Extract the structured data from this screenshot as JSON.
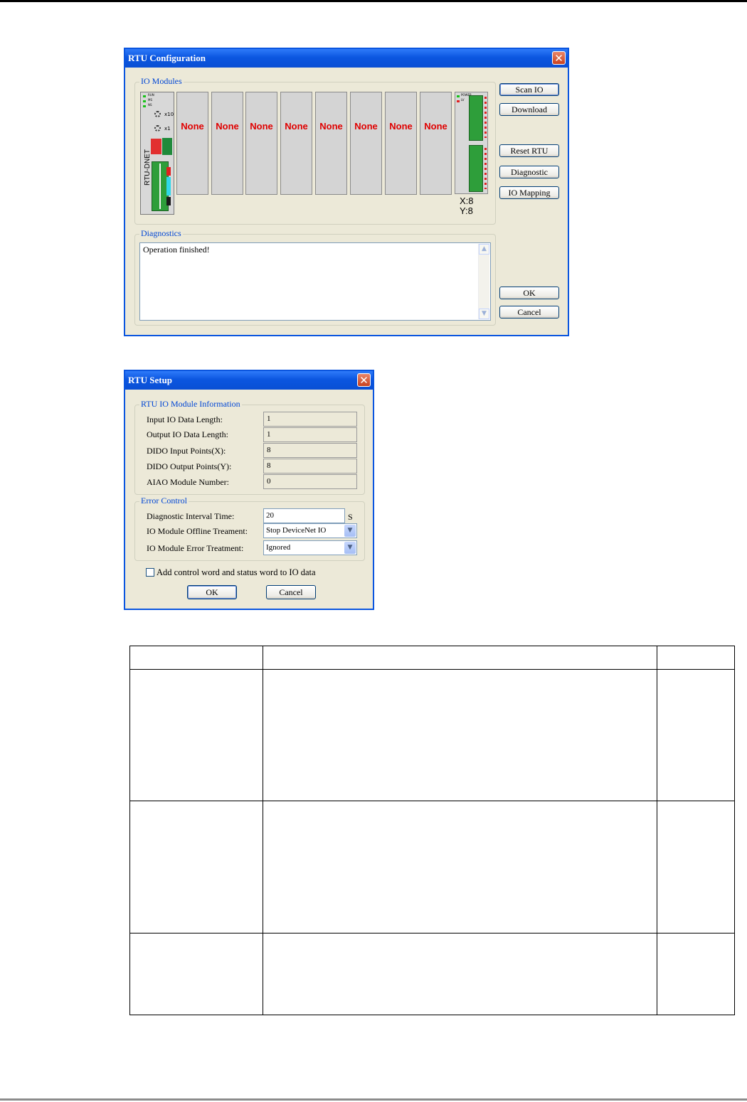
{
  "rtu_configuration": {
    "title": "RTU Configuration",
    "close_glyph": "✕",
    "io_modules_label": "IO Modules",
    "rtu_module": {
      "name": "RTU-DNET",
      "led_labels": [
        "RUN",
        "MS",
        "NS"
      ],
      "switch_labels": [
        "x10",
        "x1"
      ]
    },
    "slots": [
      "None",
      "None",
      "None",
      "None",
      "None",
      "None",
      "None",
      "None"
    ],
    "io_summary": {
      "led_labels": [
        "POWER",
        "LV"
      ],
      "x": "X:8",
      "y": "Y:8"
    },
    "buttons": {
      "scan_io": "Scan IO",
      "download": "Download",
      "reset_rtu": "Reset RTU",
      "diagnostic": "Diagnostic",
      "io_mapping": "IO Mapping",
      "ok": "OK",
      "cancel": "Cancel"
    },
    "diagnostics_label": "Diagnostics",
    "diagnostics_text": "Operation finished!"
  },
  "rtu_setup": {
    "title": "RTU Setup",
    "close_glyph": "✕",
    "info_group_label": "RTU IO Module Information",
    "info_rows": [
      {
        "label": "Input IO Data Length:",
        "value": "1"
      },
      {
        "label": "Output IO Data Length:",
        "value": "1"
      },
      {
        "label": "DIDO Input Points(X):",
        "value": "8"
      },
      {
        "label": "DIDO Output Points(Y):",
        "value": "8"
      },
      {
        "label": "AIAO Module Number:",
        "value": "0"
      }
    ],
    "error_group_label": "Error Control",
    "diag_interval_label": "Diagnostic Interval Time:",
    "diag_interval_value": "20",
    "diag_interval_unit": "S",
    "offline_label": "IO Module Offline Treament:",
    "offline_value": "Stop DeviceNet IO",
    "error_label": "IO Module Error Treatment:",
    "error_value": "Ignored",
    "checkbox_label": "Add control word and status word to IO data",
    "checkbox_checked": false,
    "ok": "OK",
    "cancel": "Cancel"
  },
  "colors": {
    "titlebar": "#0a55df",
    "dialog_bg": "#ece9d8",
    "group_label": "#0046d5",
    "slot_text": "#e00000"
  }
}
